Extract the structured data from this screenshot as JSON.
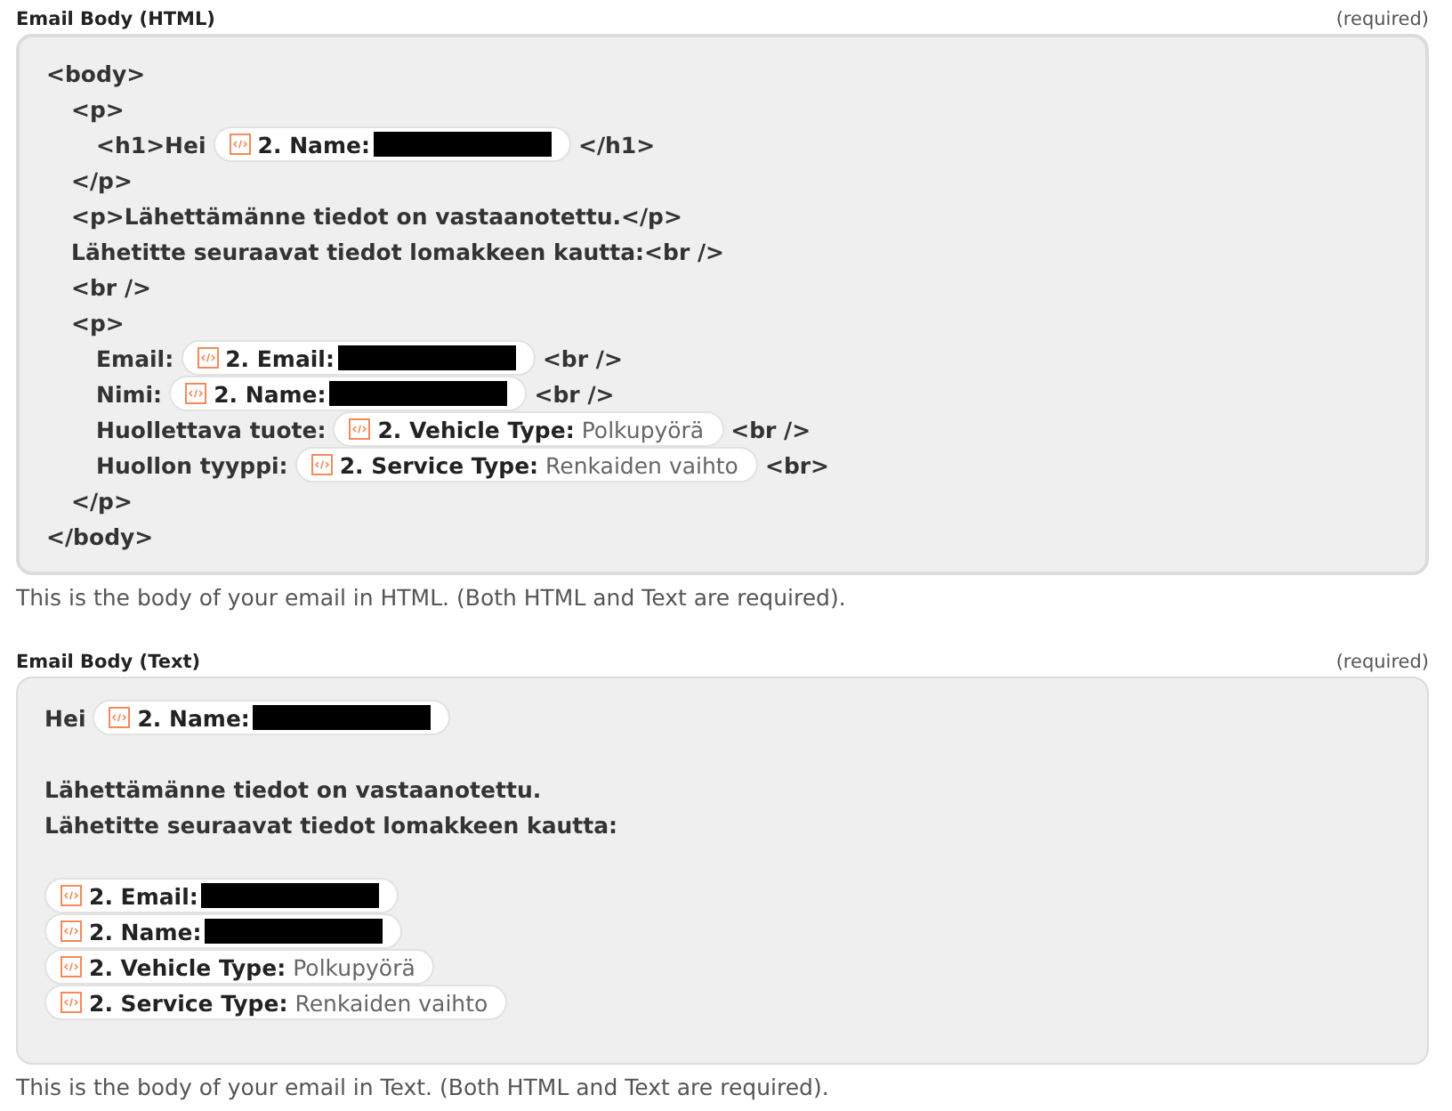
{
  "fields": [
    {
      "label": "Email Body (HTML)",
      "required": "(required)",
      "help": "This is the body of your email in HTML. (Both HTML and Text are required).",
      "kind": "tree",
      "lines": [
        {
          "segments": [
            {
              "kind": "text",
              "text": "<body>"
            }
          ],
          "children": [
            {
              "segments": [
                {
                  "kind": "text",
                  "text": "<p>"
                }
              ],
              "children": [
                {
                  "segments": [
                    {
                      "kind": "text",
                      "text": "<h1>Hei"
                    },
                    {
                      "kind": "pill",
                      "label": "2. Name:",
                      "redacted": true
                    },
                    {
                      "kind": "text",
                      "text": "</h1>"
                    }
                  ]
                }
              ]
            },
            {
              "segments": [
                {
                  "kind": "text",
                  "text": "</p>"
                }
              ]
            },
            {
              "segments": [
                {
                  "kind": "text",
                  "text": "<p>Lähettämänne tiedot on vastaanotettu.</p>"
                }
              ]
            },
            {
              "segments": [
                {
                  "kind": "text",
                  "text": "Lähetitte seuraavat tiedot lomakkeen kautta:<br />"
                }
              ]
            },
            {
              "segments": [
                {
                  "kind": "text",
                  "text": "<br />"
                }
              ]
            },
            {
              "segments": [
                {
                  "kind": "text",
                  "text": "<p>"
                }
              ],
              "children": [
                {
                  "segments": [
                    {
                      "kind": "text",
                      "text": "Email:"
                    },
                    {
                      "kind": "pill",
                      "label": "2. Email:",
                      "redacted": true
                    },
                    {
                      "kind": "text",
                      "text": "<br />"
                    }
                  ]
                },
                {
                  "segments": [
                    {
                      "kind": "text",
                      "text": "Nimi:"
                    },
                    {
                      "kind": "pill",
                      "label": "2. Name:",
                      "redacted": true
                    },
                    {
                      "kind": "text",
                      "text": "<br />"
                    }
                  ]
                },
                {
                  "segments": [
                    {
                      "kind": "text",
                      "text": "Huollettava tuote:"
                    },
                    {
                      "kind": "pill",
                      "label": "2. Vehicle Type:",
                      "value": "Polkupyörä"
                    },
                    {
                      "kind": "text",
                      "text": "<br />"
                    }
                  ]
                },
                {
                  "segments": [
                    {
                      "kind": "text",
                      "text": "Huollon tyyppi:"
                    },
                    {
                      "kind": "pill",
                      "label": "2. Service Type:",
                      "value": "Renkaiden vaihto"
                    },
                    {
                      "kind": "text",
                      "text": "<br>"
                    }
                  ]
                }
              ]
            },
            {
              "segments": [
                {
                  "kind": "text",
                  "text": "</p>"
                }
              ]
            }
          ]
        },
        {
          "segments": [
            {
              "kind": "text",
              "text": "</body>"
            }
          ]
        }
      ]
    },
    {
      "label": "Email Body (Text)",
      "required": "(required)",
      "help": "This is the body of your email in Text. (Both HTML and Text are required).",
      "kind": "paragraphs",
      "paragraphs": [
        [
          {
            "segments": [
              {
                "kind": "text",
                "text": "Hei"
              },
              {
                "kind": "pill",
                "label": "2. Name:",
                "redacted": true
              }
            ]
          }
        ],
        [
          {
            "segments": [
              {
                "kind": "text",
                "text": "Lähettämänne tiedot on vastaanotettu."
              }
            ]
          },
          {
            "segments": [
              {
                "kind": "text",
                "text": "Lähetitte seuraavat tiedot lomakkeen kautta:"
              }
            ]
          }
        ],
        [
          {
            "segments": [
              {
                "kind": "pill",
                "label": "2. Email:",
                "redacted": true
              }
            ]
          },
          {
            "segments": [
              {
                "kind": "pill",
                "label": "2. Name:",
                "redacted": true
              }
            ]
          },
          {
            "segments": [
              {
                "kind": "pill",
                "label": "2. Vehicle Type:",
                "value": "Polkupyörä"
              }
            ]
          },
          {
            "segments": [
              {
                "kind": "pill",
                "label": "2. Service Type:",
                "value": "Renkaiden vaihto"
              }
            ]
          }
        ]
      ]
    }
  ]
}
